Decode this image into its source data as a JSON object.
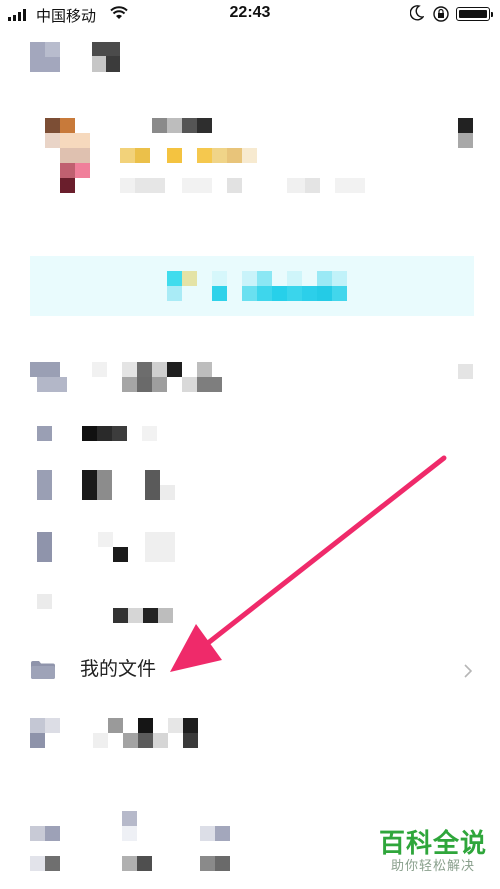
{
  "status_bar": {
    "carrier": "中国移动",
    "time": "22:43"
  },
  "menu": {
    "my_files": {
      "label": "我的文件",
      "icon": "folder-icon"
    }
  },
  "watermark": {
    "title": "百科全说",
    "subtitle": "助你轻松解决"
  },
  "colors": {
    "banner_bg": "#e9fbfd",
    "arrow": "#ef2a6a",
    "watermark_green": "#2fa63b",
    "mosaic_gray": "#9a9fb4",
    "mosaic_cyan": "#27d6ee"
  }
}
